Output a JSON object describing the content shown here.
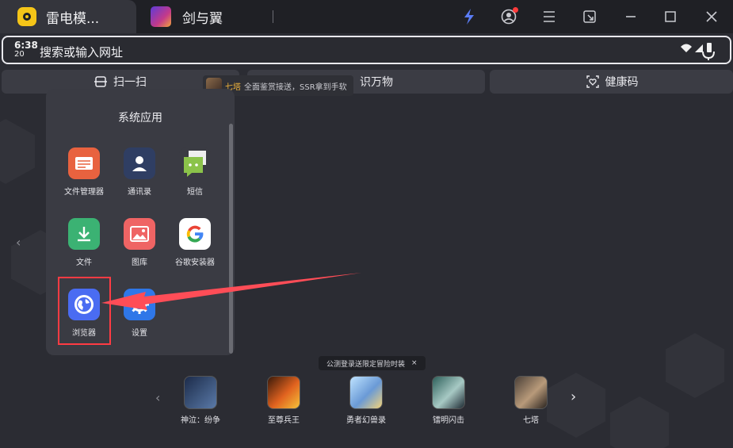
{
  "titlebar": {
    "tabs": [
      {
        "label": "雷电模..."
      },
      {
        "label": "剑与翼"
      }
    ]
  },
  "addressbar": {
    "time": "6:38",
    "time_sub": "20",
    "placeholder": "搜索或输入网址"
  },
  "shortcuts": [
    {
      "label": "扫一扫"
    },
    {
      "label": "识万物"
    },
    {
      "label": ""
    },
    {
      "label": "健康码"
    }
  ],
  "notice": {
    "highlight": "七塔",
    "text": "全面鉴赏接送，SSR拿到手软"
  },
  "panel": {
    "title": "系统应用",
    "apps": [
      {
        "label": "文件管理器",
        "icon": "file-manager-icon",
        "color": "#e8623f"
      },
      {
        "label": "通讯录",
        "icon": "contacts-icon",
        "color": "#2f3e63"
      },
      {
        "label": "短信",
        "icon": "sms-icon",
        "color": "#8bc34a"
      },
      {
        "label": "文件",
        "icon": "download-icon",
        "color": "#3bb273"
      },
      {
        "label": "图库",
        "icon": "gallery-icon",
        "color": "#ef6464"
      },
      {
        "label": "谷歌安装器",
        "icon": "google-icon",
        "color": "#ffffff"
      },
      {
        "label": "浏览器",
        "icon": "browser-icon",
        "color": "#4a6cf2"
      },
      {
        "label": "设置",
        "icon": "settings-icon",
        "color": "#2f77e8"
      }
    ]
  },
  "dock": {
    "banner": "公测登录送限定冒险时装",
    "banner_close": "×",
    "apps": [
      {
        "label": "神泣：纷争"
      },
      {
        "label": "至尊兵王"
      },
      {
        "label": "勇者幻兽录"
      },
      {
        "label": "镭明闪击"
      },
      {
        "label": "七塔"
      }
    ]
  },
  "colors": {
    "accent": "#4a6cf2",
    "highlight_box": "#ff3b43",
    "titlebar_bg": "#1f2025",
    "desktop_bg": "#2b2c33"
  }
}
